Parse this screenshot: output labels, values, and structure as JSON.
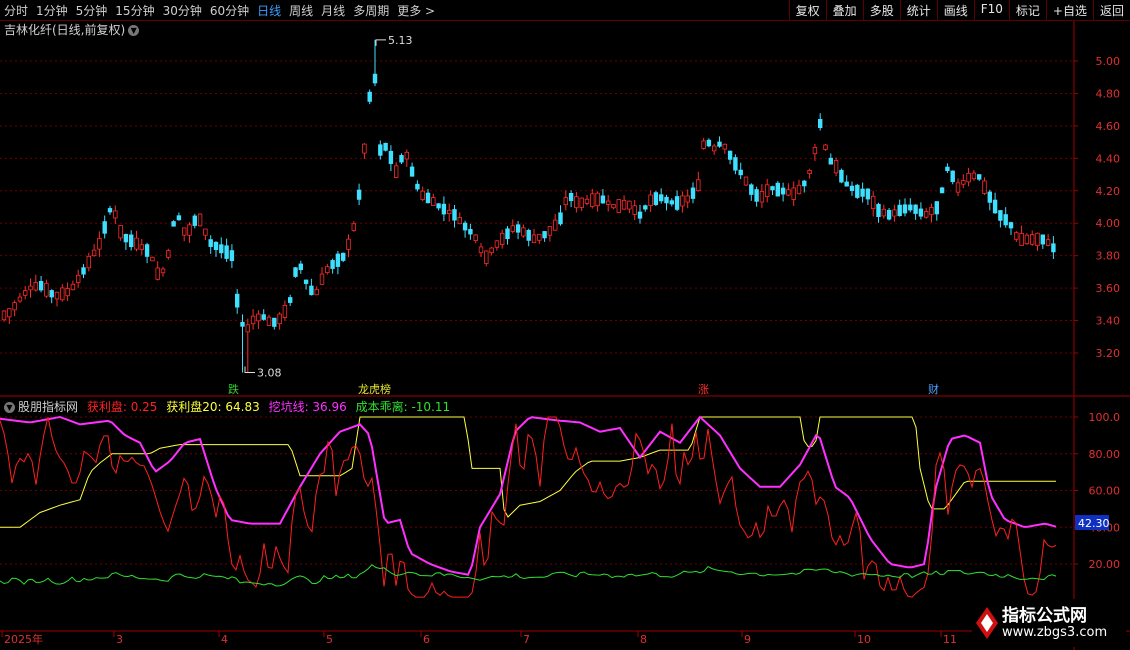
{
  "toolbar": {
    "periods": [
      "分时",
      "1分钟",
      "5分钟",
      "15分钟",
      "30分钟",
      "60分钟",
      "日线",
      "周线",
      "月线",
      "多周期",
      "更多 >"
    ],
    "active_period": "日线",
    "actions": [
      "复权",
      "叠加",
      "多股",
      "统计",
      "画线",
      "F10",
      "标记",
      "+自选",
      "返回"
    ]
  },
  "main_panel": {
    "title": "吉林化纤(日线,前复权)",
    "high_marker": "5.13",
    "low_marker": "3.08",
    "y_ticks": [
      "5.00",
      "4.80",
      "4.60",
      "4.40",
      "4.20",
      "4.00",
      "3.80",
      "3.60",
      "3.40",
      "3.20"
    ],
    "event_tags": [
      {
        "text": "跌",
        "color": "#2fd02f"
      },
      {
        "text": "龙虎榜",
        "color": "#e8e830"
      },
      {
        "text": "涨",
        "color": "#ff3030"
      },
      {
        "text": "财",
        "color": "#4aa0ff"
      }
    ]
  },
  "indicator_panel": {
    "name": "股朋指标网",
    "readouts": [
      {
        "label": "获利盘: 0.25",
        "color": "#ff2020"
      },
      {
        "label": "获利盘20: 64.83",
        "color": "#ffff40"
      },
      {
        "label": "挖坑线: 36.96",
        "color": "#ff30ff"
      },
      {
        "label": "成本乖离: -10.11",
        "color": "#30e030"
      }
    ],
    "y_ticks": [
      "100.0",
      "80.00",
      "60.00",
      "40.00",
      "20.00"
    ],
    "current_value": "42.30"
  },
  "x_axis": {
    "labels": [
      "2025年",
      "3",
      "4",
      "5",
      "6",
      "7",
      "8",
      "9",
      "10",
      "11"
    ]
  },
  "watermark": {
    "title": "指标公式网",
    "url": "www.zbgs3.com"
  },
  "colors": {
    "up": "#ff2a2a",
    "down": "#3fe0ff",
    "grid": "#6a0000",
    "axis": "#a00000"
  }
}
